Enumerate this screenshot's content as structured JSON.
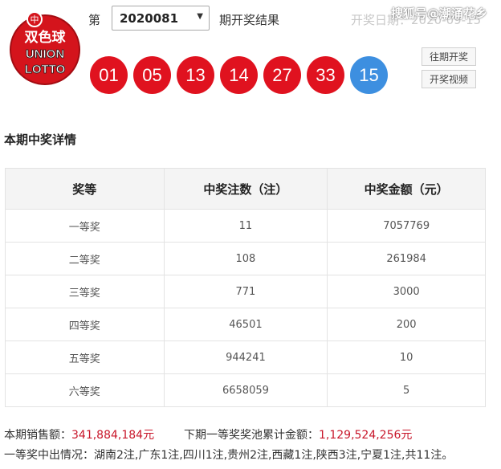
{
  "logo": {
    "text_top": "双色球",
    "text_mid": "UNION",
    "text_bot": "LOTTO"
  },
  "header": {
    "issue_prefix": "第",
    "issue_number": "2020081",
    "issue_suffix": "期开奖结果",
    "draw_date": "开奖日期：2020-09-15",
    "watermark": "搜狐号@潮涌花乡"
  },
  "balls": [
    {
      "number": "01",
      "color": "red"
    },
    {
      "number": "05",
      "color": "red"
    },
    {
      "number": "13",
      "color": "red"
    },
    {
      "number": "14",
      "color": "red"
    },
    {
      "number": "27",
      "color": "red"
    },
    {
      "number": "33",
      "color": "red"
    },
    {
      "number": "15",
      "color": "blue"
    }
  ],
  "colors": {
    "red_ball": "#e0121f",
    "blue_ball": "#3d8fe0",
    "amount_red": "#c8162a"
  },
  "buttons": {
    "past_draws": "往期开奖",
    "draw_video": "开奖视频"
  },
  "section_title": "本期中奖详情",
  "table": {
    "headers": [
      "奖等",
      "中奖注数（注）",
      "中奖金额（元）"
    ],
    "rows": [
      [
        "一等奖",
        "11",
        "7057769"
      ],
      [
        "二等奖",
        "108",
        "261984"
      ],
      [
        "三等奖",
        "771",
        "3000"
      ],
      [
        "四等奖",
        "46501",
        "200"
      ],
      [
        "五等奖",
        "944241",
        "10"
      ],
      [
        "六等奖",
        "6658059",
        "5"
      ]
    ]
  },
  "summary": {
    "sales_label": "本期销售额：",
    "sales_value": "341,884,184元",
    "pool_label": "下期一等奖奖池累计金额：",
    "pool_value": "1,129,524,256元",
    "first_prize_detail": "一等奖中出情况：湖南2注,广东1注,四川1注,贵州2注,西藏1注,陕西3注,宁夏1注,共11注。"
  }
}
